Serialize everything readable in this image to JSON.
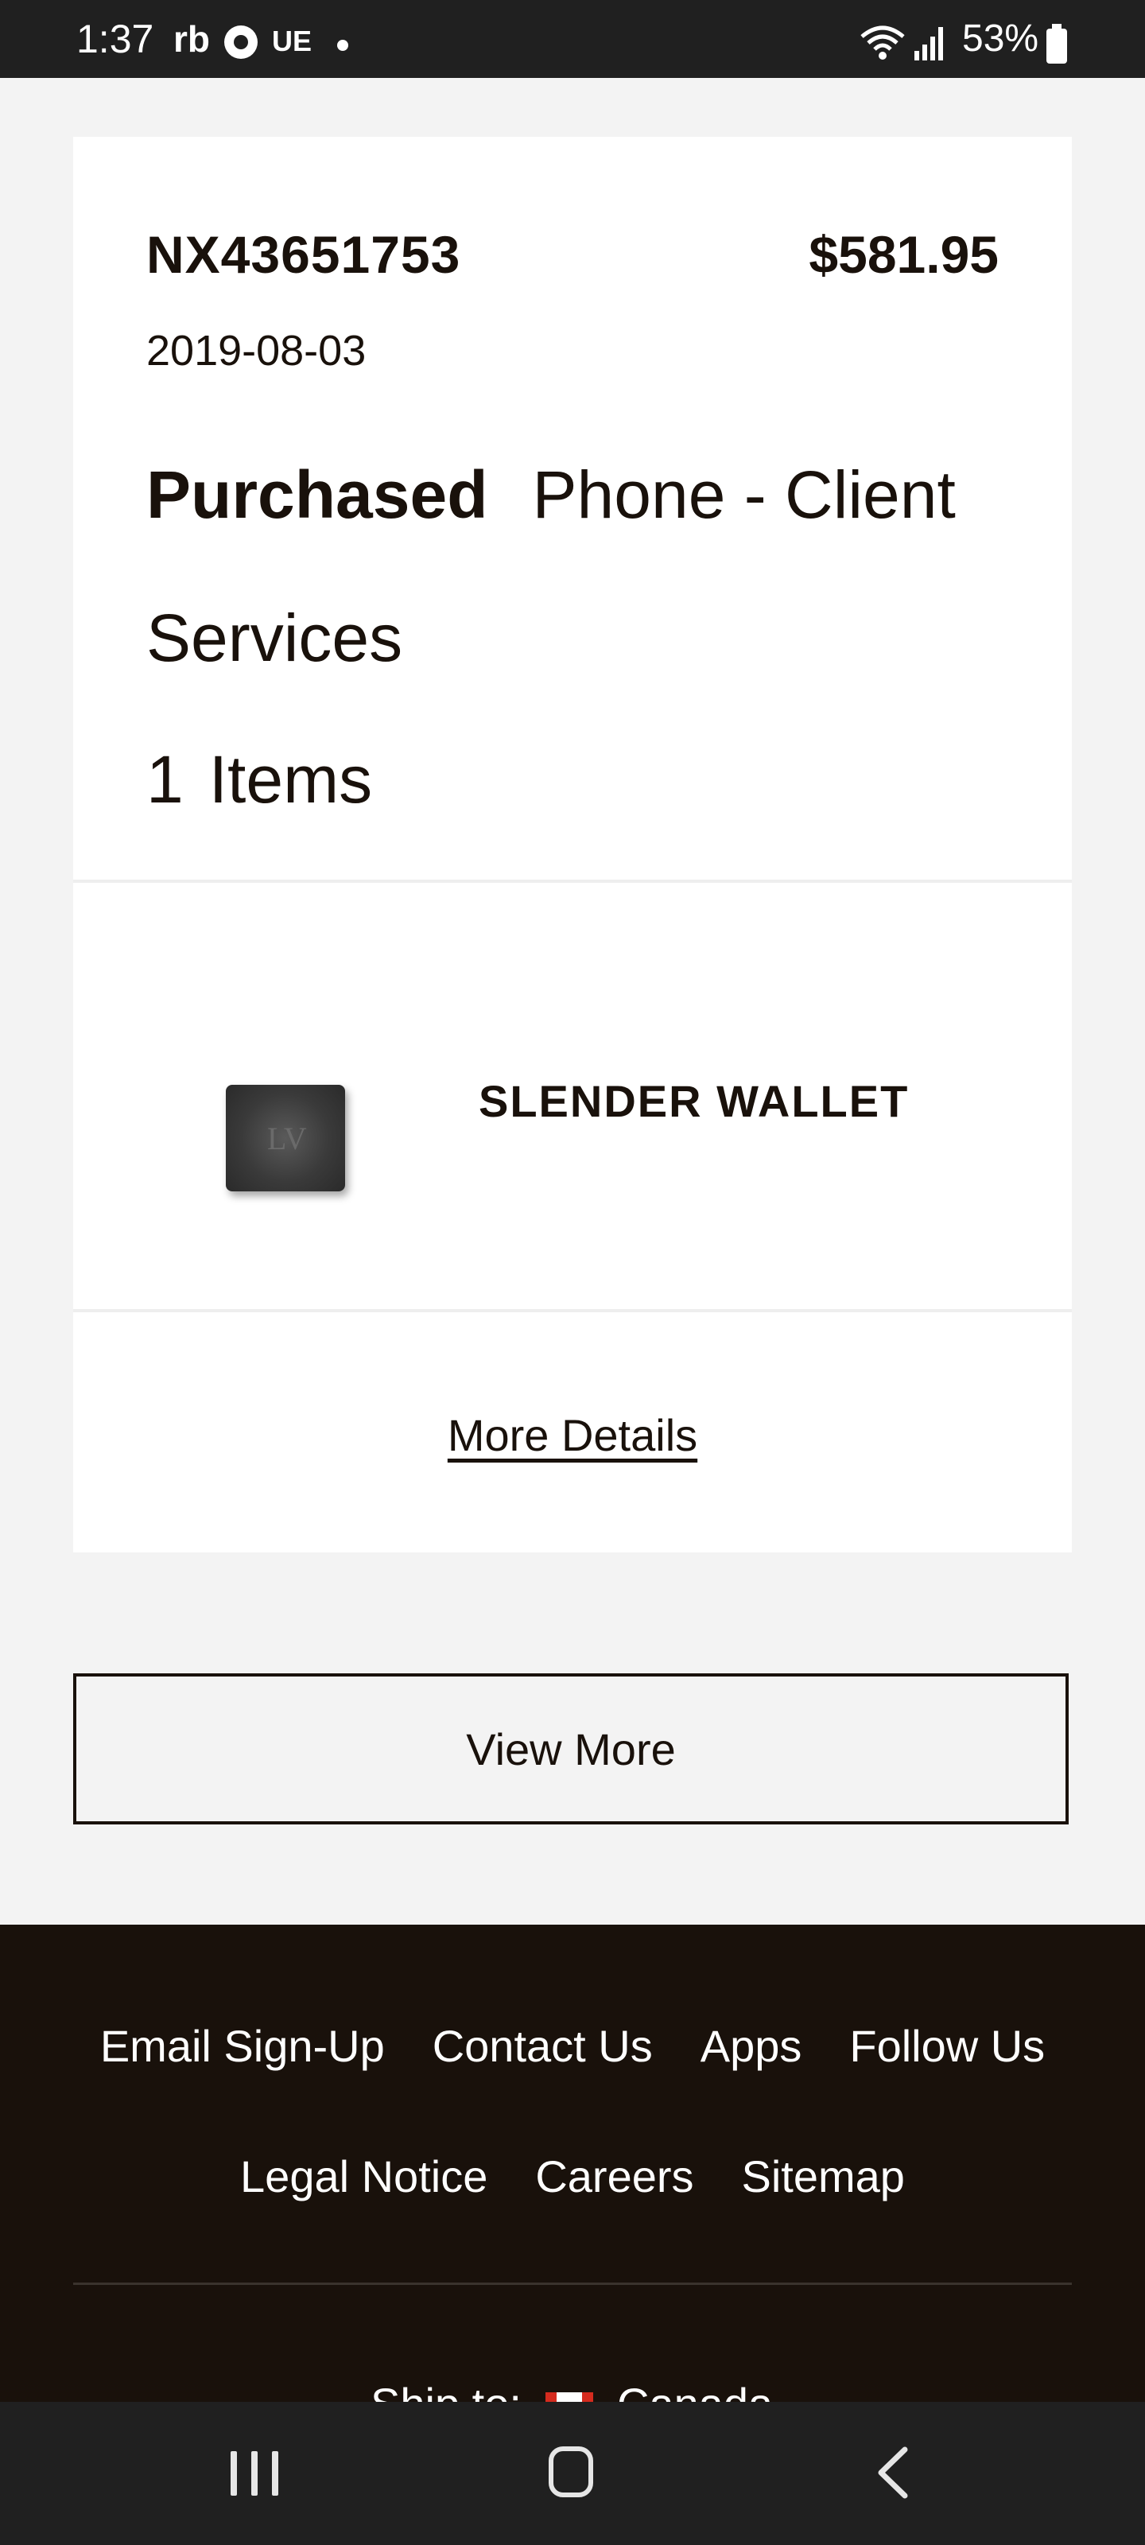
{
  "status_bar": {
    "time": "1:37",
    "app_icon_rb": "rb",
    "app_icon_ue": "UE",
    "battery_percent": "53%"
  },
  "order": {
    "id": "NX43651753",
    "total": "$581.95",
    "date": "2019-08-03",
    "status": "Purchased",
    "channel": "Phone - Client Services",
    "item_count": "1",
    "item_count_label": "Items"
  },
  "product": {
    "name": "SLENDER WALLET",
    "image_icon": "wallet-image"
  },
  "actions": {
    "more_details": "More Details",
    "view_more": "View More"
  },
  "footer": {
    "links_row1": [
      "Email Sign-Up",
      "Contact Us",
      "Apps",
      "Follow Us"
    ],
    "links_row2": [
      "Legal Notice",
      "Careers",
      "Sitemap"
    ],
    "ship_to_label": "Ship to:",
    "country": "Canada"
  },
  "colors": {
    "page_background": "#f3f3f3",
    "card_background": "#ffffff",
    "text_primary": "#19110b",
    "footer_background": "#19110b",
    "system_bar": "#202020"
  }
}
